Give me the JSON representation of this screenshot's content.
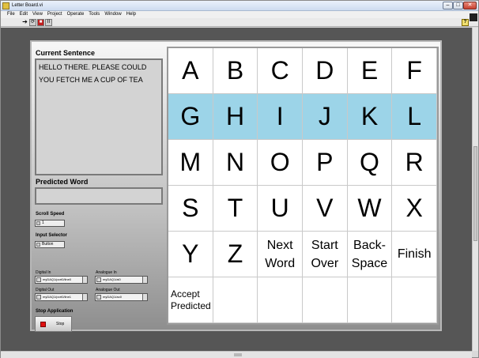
{
  "window": {
    "title": "Letter Board.vi"
  },
  "menu": [
    "File",
    "Edit",
    "View",
    "Project",
    "Operate",
    "Tools",
    "Window",
    "Help"
  ],
  "toolbar": {
    "run": "➔",
    "run_continuous": "⟳",
    "abort": "■",
    "pause": "II"
  },
  "panel": {
    "sentence_label": "Current Sentence",
    "sentence_text": "HELLO THERE. PLEASE COULD YOU FETCH ME A CUP OF TEA",
    "predicted_label": "Predicted Word",
    "predicted_value": "",
    "scroll_speed_label": "Scroll Speed",
    "scroll_speed_value": "1",
    "input_selector_label": "Input Selector",
    "input_selector_value": "Button",
    "digital_in_label": "Digital In",
    "digital_in_value": "myDAQ1/port0/line0",
    "analogue_in_label": "Analogue In",
    "analogue_in_value": "myDAQ1/ai0",
    "digital_out_label": "Digital Out",
    "digital_out_value": "myDAQ1/port0/line1",
    "analogue_out_label": "Analogue Out",
    "analogue_out_value": "myDAQ1/ao0",
    "stop_label": "Stop Application",
    "stop_button": "Stop"
  },
  "grid": {
    "highlight_color": "#9cd4e8",
    "highlighted_row": 1,
    "cells": [
      "A",
      "B",
      "C",
      "D",
      "E",
      "F",
      "G",
      "H",
      "I",
      "J",
      "K",
      "L",
      "M",
      "N",
      "O",
      "P",
      "Q",
      "R",
      "S",
      "T",
      "U",
      "V",
      "W",
      "X",
      "Y",
      "Z",
      "Next Word",
      "Start Over",
      "Back-Space",
      "Finish",
      "Accept Predicted",
      "",
      "",
      "",
      "",
      ""
    ]
  }
}
